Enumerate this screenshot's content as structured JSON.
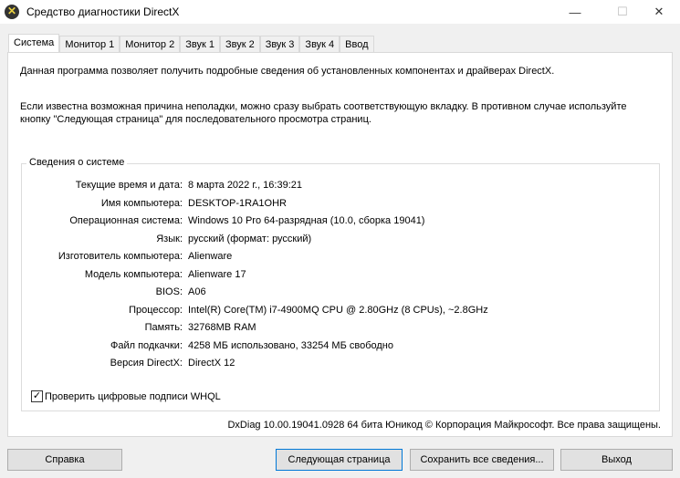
{
  "window": {
    "title": "Средство диагностики DirectX",
    "minimize": "—",
    "maximize": "☐",
    "close": "✕"
  },
  "tabs": [
    "Система",
    "Монитор 1",
    "Монитор 2",
    "Звук 1",
    "Звук 2",
    "Звук 3",
    "Звук 4",
    "Ввод"
  ],
  "intro1": "Данная программа позволяет получить подробные сведения об установленных компонентах и драйверах DirectX.",
  "intro2": "Если известна возможная причина неполадки, можно сразу выбрать соответствующую вкладку. В противном случае используйте кнопку \"Следующая страница\" для последовательного просмотра страниц.",
  "group": {
    "title": "Сведения о системе",
    "rows": [
      {
        "label": "Текущие время и дата:",
        "value": "8 марта 2022 г., 16:39:21"
      },
      {
        "label": "Имя компьютера:",
        "value": "DESKTOP-1RA1OHR"
      },
      {
        "label": "Операционная система:",
        "value": "Windows 10 Pro 64-разрядная (10.0, сборка 19041)"
      },
      {
        "label": "Язык:",
        "value": "русский (формат: русский)"
      },
      {
        "label": "Изготовитель компьютера:",
        "value": "Alienware"
      },
      {
        "label": "Модель компьютера:",
        "value": "Alienware 17"
      },
      {
        "label": "BIOS:",
        "value": "A06"
      },
      {
        "label": "Процессор:",
        "value": "Intel(R) Core(TM) i7-4900MQ CPU @ 2.80GHz (8 CPUs), ~2.8GHz"
      },
      {
        "label": "Память:",
        "value": "32768MB RAM"
      },
      {
        "label": "Файл подкачки:",
        "value": "4258 МБ использовано, 33254 МБ свободно"
      },
      {
        "label": "Версия DirectX:",
        "value": "DirectX 12"
      }
    ]
  },
  "whql": {
    "label": "Проверить цифровые подписи WHQL",
    "checked": true,
    "mark": "✓"
  },
  "footer": "DxDiag 10.00.19041.0928 64 бита Юникод © Корпорация Майкрософт. Все права защищены.",
  "buttons": {
    "help": "Справка",
    "next": "Следующая страница",
    "save": "Сохранить все сведения...",
    "exit": "Выход"
  }
}
